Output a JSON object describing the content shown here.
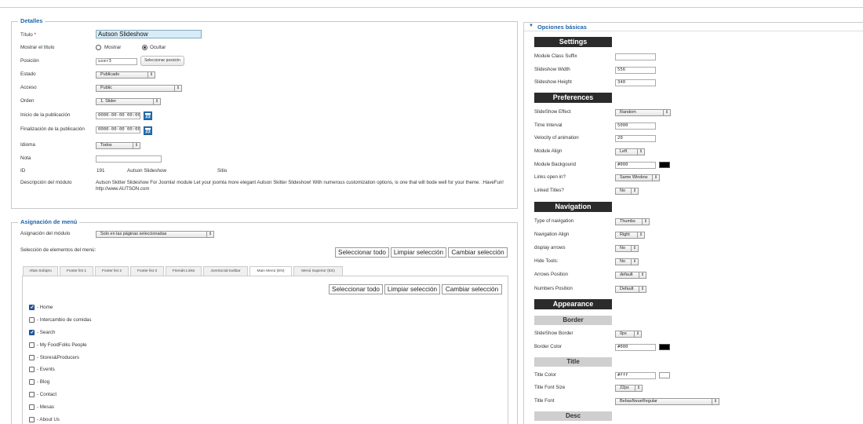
{
  "details": {
    "legend": "Detalles",
    "title_label": "Título",
    "title_required": "*",
    "title_value": "Autson Slideshow",
    "show_title_label": "Mostrar el título",
    "show_option": "Mostrar",
    "hide_option": "Ocultar",
    "show_title_selected": "Ocultar",
    "position_label": "Posición",
    "position_value": "user3",
    "select_position_button": "Seleccionar posición",
    "status_label": "Estado",
    "status_value": "Publicado",
    "access_label": "Acceso",
    "access_value": "Public",
    "order_label": "Orden",
    "order_value": "1. Slider",
    "publish_start_label": "Inicio de la publicación",
    "publish_start_value": "0000-00-00 00:00:",
    "publish_end_label": "Finalización de la publicación",
    "publish_end_value": "0000-00-00 00:00:",
    "calendar_day": "23",
    "language_label": "Idioma",
    "language_value": "Todos",
    "note_label": "Nota",
    "note_value": "",
    "id_label": "ID",
    "id_value": "191",
    "id_module": "Autson Slideshow",
    "id_site": "Sitio",
    "description_label": "Descripción del módulo",
    "description_value": "Autson Skitter Slideshow For Joomla! module Let your joomla more elegant Autson Skitter Slideshow! With numerous customization options, is one that will bode well for your theme. :HaveFun! http://www.AUTSON.com"
  },
  "menu_assignment": {
    "legend": "Asignación de menú",
    "module_assignment_label": "Asignación del módulo",
    "module_assignment_value": "Solo en las páginas seleccionadas",
    "menu_items_selection_label": "Selección de elementos del menú:",
    "select_all": "Seleccionar todo",
    "clear_selection": "Limpiar selección",
    "toggle_selection": "Cambiar selección",
    "tabs": [
      {
        "label": "Altas Sobipro",
        "active": false
      },
      {
        "label": "Footer list 1",
        "active": false
      },
      {
        "label": "Footer list 2",
        "active": false
      },
      {
        "label": "Footer list 3",
        "active": false
      },
      {
        "label": "Friends Links",
        "active": false
      },
      {
        "label": "JomSocial toolbar",
        "active": false
      },
      {
        "label": "Main Menú (EN)",
        "active": true
      },
      {
        "label": "Menú Superior (ES)",
        "active": false
      }
    ],
    "items": [
      {
        "label": "- Home",
        "checked": true
      },
      {
        "label": "- Intercambio de comidas",
        "checked": false
      },
      {
        "label": "- Search",
        "checked": true
      },
      {
        "label": "- My FoodFolks People",
        "checked": false
      },
      {
        "label": "- Stores&Producers",
        "checked": false
      },
      {
        "label": "- Events",
        "checked": false
      },
      {
        "label": "- Blog",
        "checked": false
      },
      {
        "label": "- Contact",
        "checked": false
      },
      {
        "label": "- Mesas",
        "checked": false
      },
      {
        "label": "- About Us",
        "checked": false
      }
    ]
  },
  "basic_options": {
    "panel_title": "Opciones básicas",
    "settings_header": "Settings",
    "module_class_suffix_label": "Module Class Suffix",
    "module_class_suffix_value": "",
    "slideshow_width_label": "Slideshow Width",
    "slideshow_width_value": "556",
    "slideshow_height_label": "Slideshow Height",
    "slideshow_height_value": "340",
    "preferences_header": "Preferences",
    "effect_label": "SlideShow Effect",
    "effect_value": "Random",
    "time_interval_label": "Time Interval",
    "time_interval_value": "5000",
    "velocity_label": "Velocity of animation",
    "velocity_value": "20",
    "module_align_label": "Module Align",
    "module_align_value": "Left",
    "module_background_label": "Module Backgound",
    "module_background_value": "#000",
    "module_background_color": "#000000",
    "links_open_label": "Links open in?",
    "links_open_value": "Same Window",
    "linked_titles_label": "Linked Titles?",
    "linked_titles_value": "No",
    "navigation_header": "Navigation",
    "nav_type_label": "Type of navigation",
    "nav_type_value": "Thumbs",
    "nav_align_label": "Navigation Align",
    "nav_align_value": "Right",
    "display_arrows_label": "display arrows",
    "display_arrows_value": "No",
    "hide_tools_label": "Hide Tools:",
    "hide_tools_value": "No",
    "arrows_position_label": "Arrows Position",
    "arrows_position_value": "default",
    "numbers_position_label": "Numbers Position",
    "numbers_position_value": "Default",
    "appearance_header": "Appearance",
    "border_header": "Border",
    "slideshow_border_label": "SlideShow Border",
    "slideshow_border_value": "0px",
    "border_color_label": "Border Color",
    "border_color_value": "#000",
    "border_color_swatch": "#000000",
    "title_header": "Title",
    "title_color_label": "Title Color",
    "title_color_value": "#fff",
    "title_color_swatch": "#ffffff",
    "title_font_size_label": "Title Font Size",
    "title_font_size_value": "22px",
    "title_font_label": "Title Font",
    "title_font_value": "BebasNeueRegular",
    "desc_header": "Desc"
  },
  "colors": {
    "legend_blue": "#1e64aa",
    "header_dark": "#2b2b2b",
    "header_gray": "#cfcfcf",
    "calendar_blue": "#2d77b8",
    "title_input_bg": "#d6ecf8"
  }
}
